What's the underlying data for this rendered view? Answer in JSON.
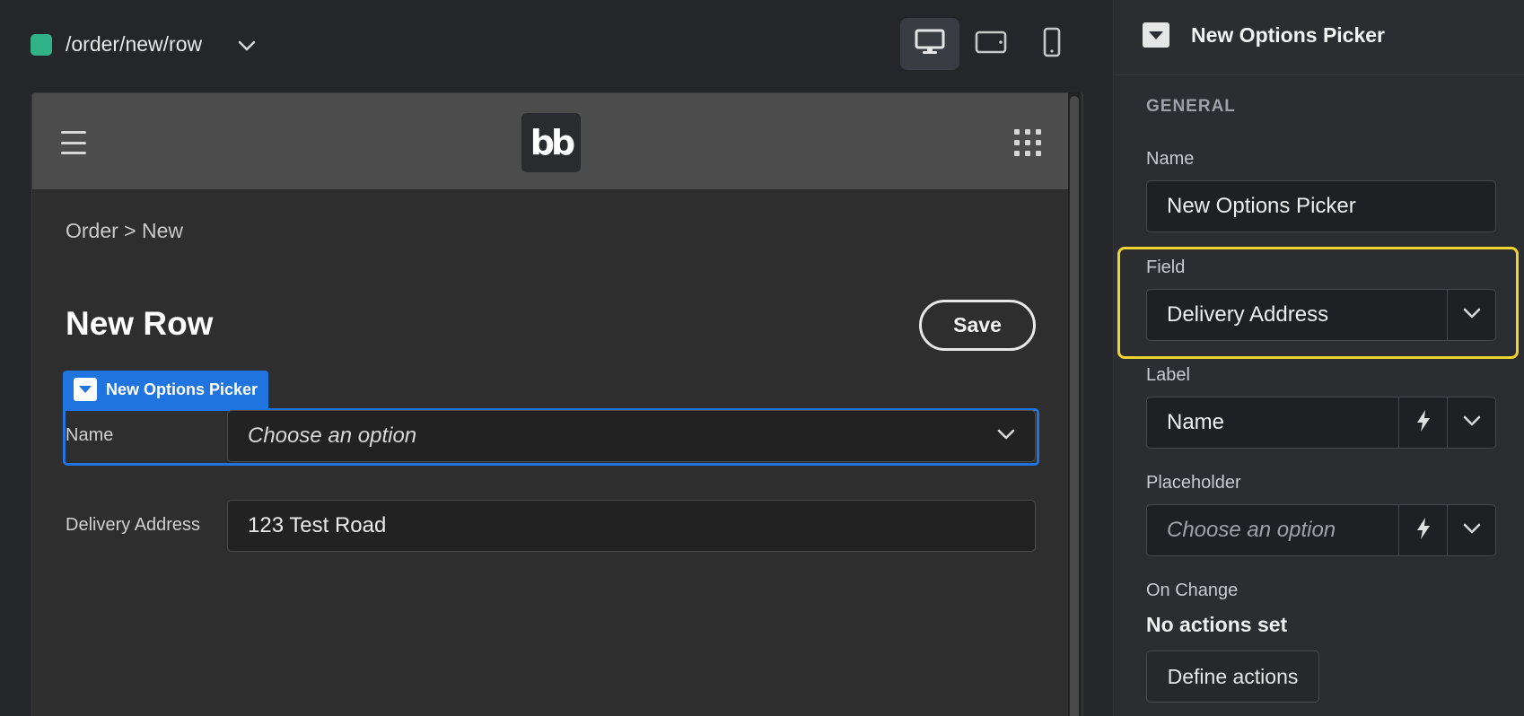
{
  "topbar": {
    "route": "/order/new/row",
    "route_color": "#2fb386",
    "devices": [
      {
        "name": "desktop",
        "active": true
      },
      {
        "name": "tablet",
        "active": false
      },
      {
        "name": "mobile",
        "active": false
      }
    ]
  },
  "preview": {
    "logo_text": "bb",
    "breadcrumb": "Order > New",
    "title": "New Row",
    "save_label": "Save",
    "picker": {
      "tag_label": "New Options Picker",
      "field_label": "Name",
      "placeholder": "Choose an option"
    },
    "delivery": {
      "label": "Delivery Address",
      "value": "123 Test Road"
    },
    "accent": "#1f74e0"
  },
  "panel": {
    "title": "New Options Picker",
    "section": "GENERAL",
    "name_label": "Name",
    "name_value": "New Options Picker",
    "field_label": "Field",
    "field_value": "Delivery Address",
    "label_label": "Label",
    "label_value": "Name",
    "placeholder_label": "Placeholder",
    "placeholder_value": "Choose an option",
    "onchange_label": "On Change",
    "no_actions": "No actions set",
    "define_actions": "Define actions",
    "highlight_color": "#f2d431"
  }
}
